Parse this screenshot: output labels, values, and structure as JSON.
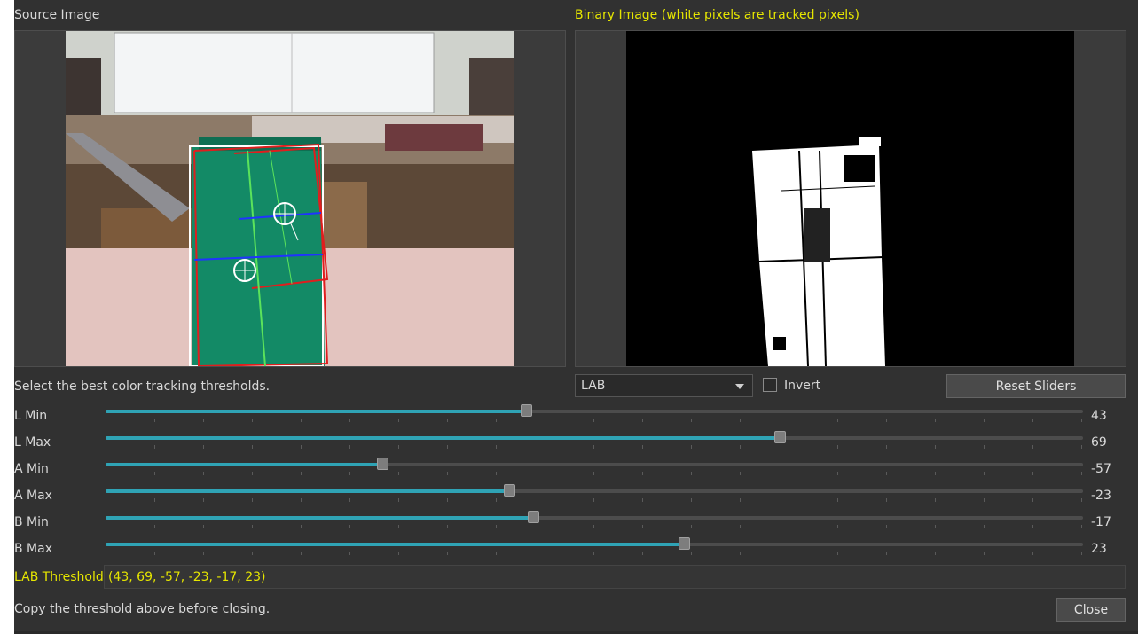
{
  "source_title": "Source Image",
  "binary_title": "Binary Image (white pixels are tracked pixels)",
  "instructions": "Select the best color tracking thresholds.",
  "colorspace_select": {
    "value": "LAB"
  },
  "invert": {
    "label": "Invert",
    "checked": false
  },
  "reset_label": "Reset Sliders",
  "sliders": [
    {
      "label": "L Min",
      "value": "43",
      "fraction": 0.43
    },
    {
      "label": "L Max",
      "value": "69",
      "fraction": 0.69
    },
    {
      "label": "A Min",
      "value": "-57",
      "fraction": 0.283
    },
    {
      "label": "A Max",
      "value": "-23",
      "fraction": 0.413
    },
    {
      "label": "B Min",
      "value": "-17",
      "fraction": 0.437
    },
    {
      "label": "B Max",
      "value": "23",
      "fraction": 0.592
    }
  ],
  "threshold": {
    "label": "LAB Threshold",
    "value": "(43, 69, -57, -23, -17, 23)"
  },
  "footer_note": "Copy the threshold above before closing.",
  "close_label": "Close",
  "colors": {
    "accent": "#2fa3b5",
    "highlight": "#e6e600"
  }
}
